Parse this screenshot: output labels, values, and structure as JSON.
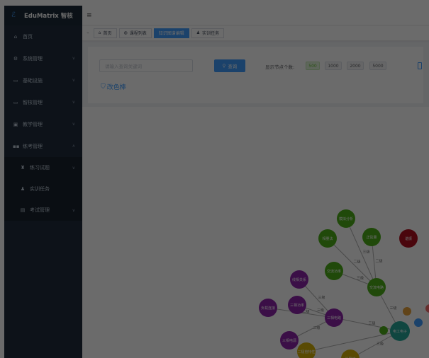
{
  "app": {
    "logo_text": "EduMatrix 智核"
  },
  "sidebar": {
    "items": [
      {
        "label": "首页",
        "icon": "home-icon",
        "glyph": "⌂"
      },
      {
        "label": "系统管理",
        "icon": "gear-icon",
        "glyph": "⚙",
        "chevron": "∨"
      },
      {
        "label": "基础设施",
        "icon": "monitor-icon",
        "glyph": "▭",
        "chevron": "∨"
      },
      {
        "label": "智核管理",
        "icon": "monitor-icon",
        "glyph": "▭",
        "chevron": "∨"
      },
      {
        "label": "教学管理",
        "icon": "book-icon",
        "glyph": "▣",
        "chevron": "∨"
      },
      {
        "label": "练考管理",
        "icon": "grid-icon",
        "glyph": "▪▪",
        "chevron": "∧"
      }
    ],
    "sub_items": [
      {
        "label": "练习试题",
        "icon": "trophy-icon",
        "glyph": "♜",
        "chevron": "∨"
      },
      {
        "label": "实训任务",
        "icon": "user-group-icon",
        "glyph": "♟"
      },
      {
        "label": "考试管理",
        "icon": "exam-icon",
        "glyph": "▤",
        "chevron": "∨"
      }
    ]
  },
  "navbar": {
    "menu_glyph": "≡"
  },
  "tags": [
    {
      "label": "首页",
      "glyph": "⌂",
      "active": false
    },
    {
      "label": "课程列表",
      "glyph": "◍",
      "active": false
    },
    {
      "label": "知识图谱编辑",
      "glyph": "",
      "active": true
    },
    {
      "label": "实训任务",
      "glyph": "♟",
      "active": false
    }
  ],
  "tag_arrow": "«",
  "search": {
    "placeholder": "请输入查询关键词",
    "button_label": "查询",
    "button_glyph": "⚲"
  },
  "node_count": {
    "label": "显示节点个数:",
    "options": [
      "500",
      "1000",
      "2000",
      "5000"
    ],
    "selected": "500"
  },
  "graph": {
    "title": "改色棒",
    "title_glyph": "⛉",
    "nodes": [
      {
        "id": "n1",
        "label": "模拟分析",
        "color": "#4caf1a"
      },
      {
        "id": "n2",
        "label": "相量法",
        "color": "#4caf1a"
      },
      {
        "id": "n3",
        "label": "正弦量",
        "color": "#4caf1a"
      },
      {
        "id": "n4",
        "label": "谐振",
        "color": "#b01020"
      },
      {
        "id": "n5",
        "label": "交流功率",
        "color": "#4caf1a"
      },
      {
        "id": "n6",
        "label": "交流电路",
        "color": "#4caf1a"
      },
      {
        "id": "n7",
        "label": "线相关系",
        "color": "#8e24aa"
      },
      {
        "id": "n8",
        "label": "三相功率",
        "color": "#8e24aa"
      },
      {
        "id": "n9",
        "label": "负载连接",
        "color": "#8e24aa"
      },
      {
        "id": "n10",
        "label": "三相电路",
        "color": "#8e24aa"
      },
      {
        "id": "n11",
        "label": "三相电源",
        "color": "#8e24aa"
      },
      {
        "id": "n12",
        "label": "电工电子",
        "color": "#26a69a"
      },
      {
        "id": "n13",
        "label": "半导体",
        "color": "#d4b106"
      },
      {
        "id": "n14",
        "label": "二极管特性",
        "color": "#d4b106"
      }
    ],
    "edge_label_samples": [
      "三级",
      "二级",
      "二级",
      "三级",
      "三级",
      "三级",
      "三级",
      "二级",
      "二级",
      "三级",
      "三级"
    ]
  }
}
